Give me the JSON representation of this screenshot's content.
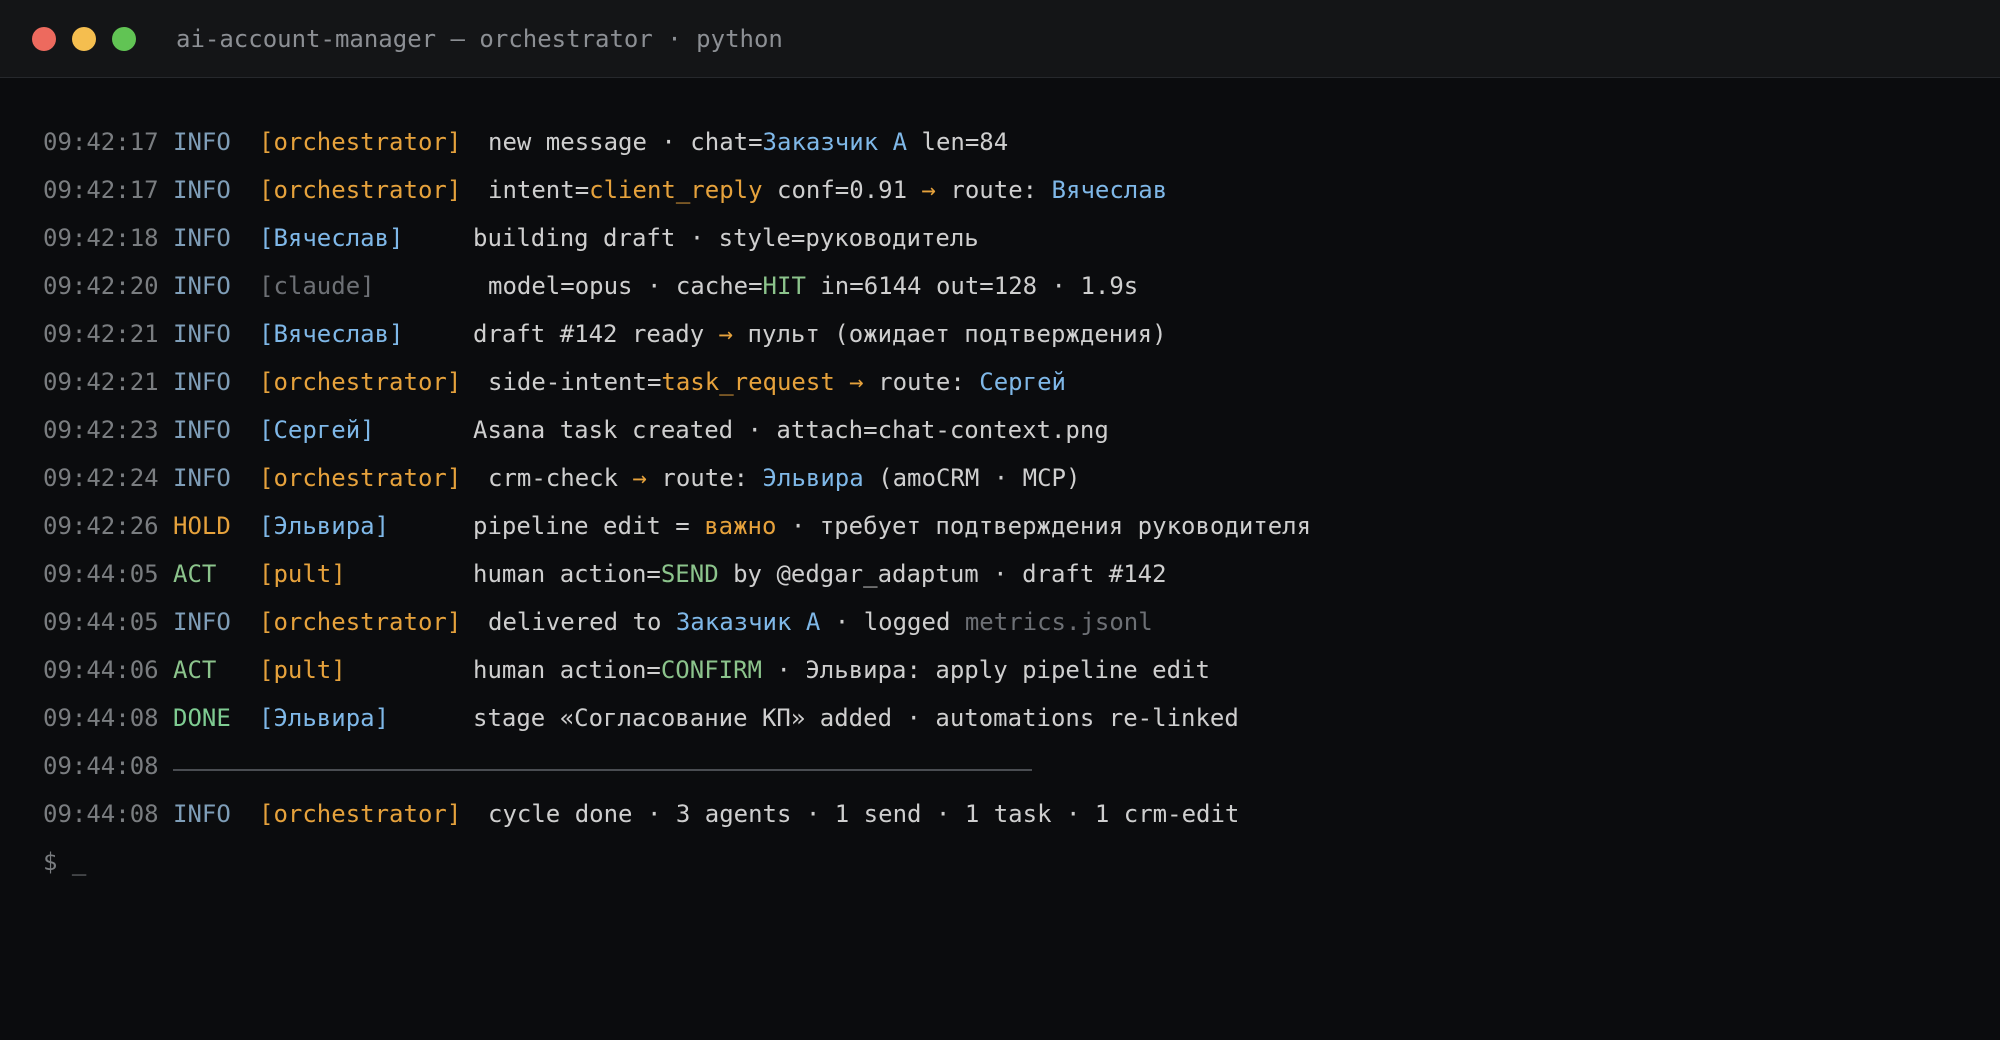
{
  "window": {
    "title": "ai-account-manager — orchestrator · python"
  },
  "log": {
    "lines": [
      {
        "time": "09:42:17",
        "level": "INFO",
        "source": "[orchestrator]",
        "msg": [
          "new message · chat=",
          "Заказчик А",
          " len=84"
        ]
      },
      {
        "time": "09:42:17",
        "level": "INFO",
        "source": "[orchestrator]",
        "msg": [
          "intent=",
          "client_reply",
          " conf=0.91 ",
          "→",
          " route: ",
          "Вячеслав"
        ]
      },
      {
        "time": "09:42:18",
        "level": "INFO",
        "source": "[Вячеслав]",
        "msg": [
          "building draft · style=руководитель"
        ]
      },
      {
        "time": "09:42:20",
        "level": "INFO",
        "source": "[claude]",
        "msg": [
          "model=opus · cache=",
          "HIT",
          " in=6144 out=128 · 1.9s"
        ]
      },
      {
        "time": "09:42:21",
        "level": "INFO",
        "source": "[Вячеслав]",
        "msg": [
          "draft #142 ready ",
          "→",
          " пульт (ожидает подтверждения)"
        ]
      },
      {
        "time": "09:42:21",
        "level": "INFO",
        "source": "[orchestrator]",
        "msg": [
          "side-intent=",
          "task_request",
          " ",
          "→",
          " route: ",
          "Сергей"
        ]
      },
      {
        "time": "09:42:23",
        "level": "INFO",
        "source": "[Сергей]",
        "msg": [
          "Asana task created · attach=chat-context.png"
        ]
      },
      {
        "time": "09:42:24",
        "level": "INFO",
        "source": "[orchestrator]",
        "msg": [
          "crm-check ",
          "→",
          " route: ",
          "Эльвира",
          " (amoCRM · MCP)"
        ]
      },
      {
        "time": "09:42:26",
        "level": "HOLD",
        "source": "[Эльвира]",
        "msg": [
          "pipeline edit = ",
          "важно",
          " · требует подтверждения руководителя"
        ]
      },
      {
        "time": "09:44:05",
        "level": "ACT",
        "source": "[pult]",
        "msg": [
          "human action=",
          "SEND",
          " by @edgar_adaptum · draft #142"
        ]
      },
      {
        "time": "09:44:05",
        "level": "INFO",
        "source": "[orchestrator]",
        "msg": [
          "delivered to ",
          "Заказчик А",
          " · logged ",
          "metrics.jsonl"
        ]
      },
      {
        "time": "09:44:06",
        "level": "ACT",
        "source": "[pult]",
        "msg": [
          "human action=",
          "CONFIRM",
          " · Эльвира: apply pipeline edit"
        ]
      },
      {
        "time": "09:44:08",
        "level": "DONE",
        "source": "[Эльвира]",
        "msg": [
          "stage «Согласование КП» added · automations re-linked"
        ]
      },
      {
        "time": "09:44:08",
        "level": "",
        "source": "",
        "msg": []
      },
      {
        "time": "09:44:08",
        "level": "INFO",
        "source": "[orchestrator]",
        "msg": [
          "cycle done · 3 agents · 1 send · 1 task · 1 crm-edit"
        ]
      }
    ]
  },
  "prompt": {
    "text": "$ _"
  },
  "colors": {
    "background": "#0b0c0e",
    "titlebar": "#141517",
    "accent_orange": "#e6a23c",
    "accent_blue": "#7fb8e8",
    "accent_green": "#8cc48c"
  }
}
